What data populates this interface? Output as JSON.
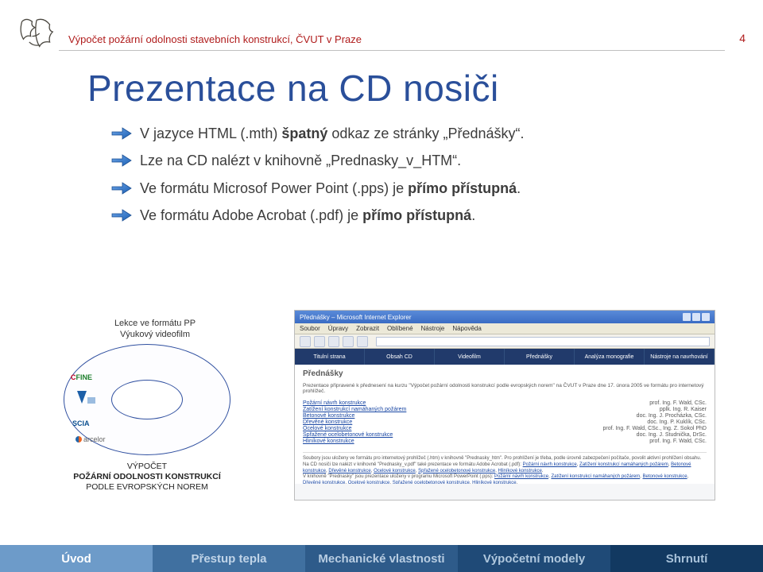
{
  "header": {
    "breadcrumb": "Výpočet požární odolnosti stavebních konstrukcí, ČVUT v Praze",
    "page_number": "4"
  },
  "title": "Prezentace na CD nosiči",
  "bullets": [
    {
      "pre": "V jazyce HTML (.mth) ",
      "bold": "špatný",
      "post": " odkaz ze stránky „Přednášky“."
    },
    {
      "pre": "Lze na CD nalézt v knihovně „Prednasky_v_HTM“.",
      "bold": "",
      "post": ""
    },
    {
      "pre": "Ve formátu  Microsof Power Point (.pps) je ",
      "bold": "přímo přístupná",
      "post": "."
    },
    {
      "pre": "Ve formátu  Adobe Acrobat (.pdf) je ",
      "bold": "přímo přístupná",
      "post": "."
    }
  ],
  "oval": {
    "above_line1": "Lekce ve formátu PP",
    "above_line2": "Výukový videofilm",
    "brand_fine_c": "C",
    "brand_fine_rest": "FINE",
    "brand_scia": "SCIA",
    "brand_arcelor": "arcelor",
    "caption_l1": "VÝPOČET",
    "caption_l2": "POŽÁRNÍ ODOLNOSTI KONSTRUKCÍ",
    "caption_l3": "PODLE EVROPSKÝCH NOREM"
  },
  "screenshot": {
    "window_title": "Přednášky – Microsoft Internet Explorer",
    "menu": [
      "Soubor",
      "Úpravy",
      "Zobrazit",
      "Oblíbené",
      "Nástroje",
      "Nápověda"
    ],
    "nav": [
      "Titulní strana",
      "Obsah CD",
      "Videofilm",
      "Přednášky",
      "Analýza monografie",
      "Nástroje na navrhování"
    ],
    "heading": "Přednášky",
    "desc": "Prezentace připravené k přednesení na kurzu \"Výpočet požární odolnosti konstrukcí podle evropských norem\" na ČVUT v Praze dne 17. února 2005 ve formátu pro internetový prohlížeč.",
    "rows": [
      {
        "l": "Požární návrh konstrukce",
        "r": "prof. Ing. F. Wald, CSc."
      },
      {
        "l": "Zatížení konstrukcí namáhaných požárem",
        "r": "pplk. Ing. R. Kaiser"
      },
      {
        "l": "Betonové konstrukce",
        "r": "doc. Ing. J. Procházka, CSc."
      },
      {
        "l": "Dřevěné konstrukce",
        "r": "doc. Ing. P. Kuklík, CSc."
      },
      {
        "l": "Ocelové konstrukce",
        "r": "prof. Ing. F. Wald, CSc., Ing. Z. Sokol PhD"
      },
      {
        "l": "Spřažené ocelobetonové konstrukce",
        "r": "doc. Ing. J. Studnička, DrSc."
      },
      {
        "l": "Hliníkové konstrukce",
        "r": "prof. Ing. F. Wald, CSc."
      }
    ],
    "note_pre": "Soubory jsou uloženy ve formátu pro internetový prohlížeč (.htm) v knihovně \"Prednasky_htm\". Pro prohlížení je třeba, podle úrovně zabezpečení počítače, povolit aktivní prohlížení obsahu.",
    "note_mid": "Na CD nosiči lze nalézt v knihovně \"Prednasky_v.pdf\" také prezentace ve formátu Adobe Acrobat (.pdf): ",
    "note_links": [
      "Požární návrh konstrukce",
      "Zatížení konstrukcí namáhaných požárem",
      "Betonové konstrukce",
      "Dřevěné konstrukce",
      "Ocelové konstrukce",
      "Spřažené ocelobetonové konstrukce",
      "Hliníkové konstrukce"
    ],
    "note_mid2": "V knihovně \"Prednasky\" jsou prezentace uloženy v programu Microsoft PowerPoint (.pps): ",
    "note_sep": ", ",
    "note_end": "."
  },
  "footer": {
    "tabs": [
      "Úvod",
      "Přestup tepla",
      "Mechanické vlastnosti",
      "Výpočetní modely",
      "Shrnutí"
    ]
  }
}
